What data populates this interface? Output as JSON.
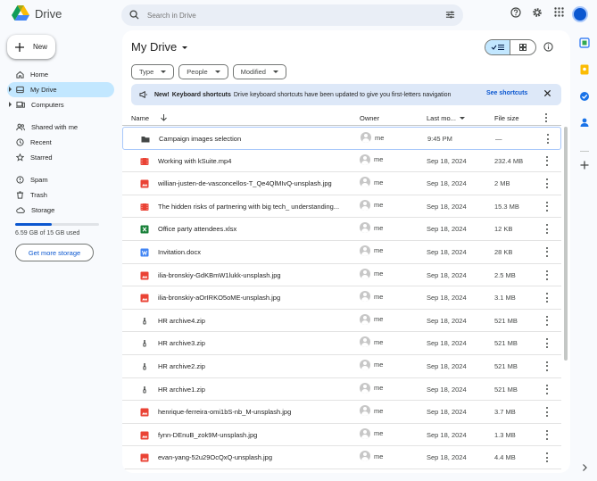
{
  "app": {
    "title": "Drive"
  },
  "search": {
    "placeholder": "Search in Drive"
  },
  "sidebar": {
    "new_label": "New",
    "items": [
      {
        "label": "Home",
        "icon": "home-icon"
      },
      {
        "label": "My Drive",
        "icon": "drive-icon",
        "active": true
      },
      {
        "label": "Computers",
        "icon": "computer-icon"
      },
      {
        "label": "Shared with me",
        "icon": "people-icon"
      },
      {
        "label": "Recent",
        "icon": "clock-icon"
      },
      {
        "label": "Starred",
        "icon": "star-icon"
      },
      {
        "label": "Spam",
        "icon": "spam-icon"
      },
      {
        "label": "Trash",
        "icon": "trash-icon"
      },
      {
        "label": "Storage",
        "icon": "cloud-icon"
      }
    ],
    "storage": {
      "text": "6.59 GB of 15 GB used",
      "fraction": 0.44
    },
    "get_more": "Get more storage"
  },
  "main": {
    "title": "My Drive",
    "filters": [
      "Type",
      "People",
      "Modified"
    ],
    "banner": {
      "prefix": "New!",
      "headline": "Keyboard shortcuts",
      "text": "Drive keyboard shortcuts have been updated to give you first-letters navigation",
      "link": "See shortcuts"
    },
    "columns": {
      "name": "Name",
      "owner": "Owner",
      "modified": "Last mo...",
      "size": "File size"
    },
    "files": [
      {
        "name": "Campaign images selection",
        "type": "folder",
        "owner": "me",
        "modified": "9:45 PM",
        "size": "—"
      },
      {
        "name": "Working with kSuite.mp4",
        "type": "video",
        "owner": "me",
        "modified": "Sep 18, 2024",
        "size": "232.4 MB"
      },
      {
        "name": "willian-justen-de-vasconcellos-T_Qe4QlMIvQ-unsplash.jpg",
        "type": "image",
        "owner": "me",
        "modified": "Sep 18, 2024",
        "size": "2 MB"
      },
      {
        "name": "The hidden risks of partnering with big tech_ understanding...",
        "type": "video",
        "owner": "me",
        "modified": "Sep 18, 2024",
        "size": "15.3 MB"
      },
      {
        "name": "Office party attendees.xlsx",
        "type": "sheet",
        "owner": "me",
        "modified": "Sep 18, 2024",
        "size": "12 KB"
      },
      {
        "name": "Invitation.docx",
        "type": "doc",
        "owner": "me",
        "modified": "Sep 18, 2024",
        "size": "28 KB"
      },
      {
        "name": "ilia-bronskiy-GdKBmW1lukk-unsplash.jpg",
        "type": "image",
        "owner": "me",
        "modified": "Sep 18, 2024",
        "size": "2.5 MB"
      },
      {
        "name": "ilia-bronskiy-aOrIRKO5oME-unsplash.jpg",
        "type": "image",
        "owner": "me",
        "modified": "Sep 18, 2024",
        "size": "3.1 MB"
      },
      {
        "name": "HR archive4.zip",
        "type": "zip",
        "owner": "me",
        "modified": "Sep 18, 2024",
        "size": "521 MB"
      },
      {
        "name": "HR archive3.zip",
        "type": "zip",
        "owner": "me",
        "modified": "Sep 18, 2024",
        "size": "521 MB"
      },
      {
        "name": "HR archive2.zip",
        "type": "zip",
        "owner": "me",
        "modified": "Sep 18, 2024",
        "size": "521 MB"
      },
      {
        "name": "HR archive1.zip",
        "type": "zip",
        "owner": "me",
        "modified": "Sep 18, 2024",
        "size": "521 MB"
      },
      {
        "name": "henrique-ferreira-omi1bS-nb_M-unsplash.jpg",
        "type": "image",
        "owner": "me",
        "modified": "Sep 18, 2024",
        "size": "3.7 MB"
      },
      {
        "name": "fynn-DEnuB_zok9M-unsplash.jpg",
        "type": "image",
        "owner": "me",
        "modified": "Sep 18, 2024",
        "size": "1.3 MB"
      },
      {
        "name": "evan-yang-52u29OcQxQ-unsplash.jpg",
        "type": "image",
        "owner": "me",
        "modified": "Sep 18, 2024",
        "size": "4.4 MB"
      }
    ]
  },
  "colors": {
    "accent": "#0b57d0",
    "active_nav": "#c2e7ff",
    "banner": "#dde8f8",
    "folder": "#444746",
    "image": "#ea4335",
    "video": "#ea4335",
    "sheet": "#188038",
    "doc": "#4285f4"
  }
}
